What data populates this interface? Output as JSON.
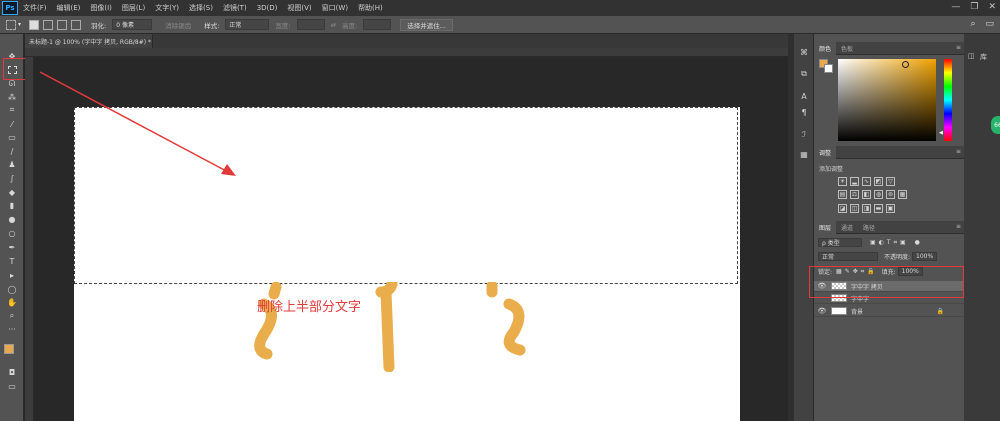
{
  "app": {
    "logo": "Ps"
  },
  "menu": [
    "文件(F)",
    "编辑(E)",
    "图像(I)",
    "图层(L)",
    "文字(Y)",
    "选择(S)",
    "滤镜(T)",
    "3D(D)",
    "视图(V)",
    "窗口(W)",
    "帮助(H)"
  ],
  "window_controls": [
    "—",
    "❐",
    "✕"
  ],
  "options": {
    "feather_label": "羽化:",
    "feather_value": "0 像素",
    "antialias_label": "消除锯齿",
    "style_label": "样式:",
    "style_value": "正常",
    "width_label": "宽度:",
    "height_label": "高度:",
    "select_mask_button": "选择并遮住..."
  },
  "document": {
    "tab_title": "未标题-1 @ 100% (字中字 拷贝, RGB/8#) *",
    "close": "×"
  },
  "annotation": {
    "text": "删除上半部分文字"
  },
  "panels": {
    "color_tabs": [
      "颜色",
      "色板"
    ],
    "adjust_tab": "调整",
    "adjust_label": "添加调整",
    "layers_tabs": [
      "图层",
      "通道",
      "路径"
    ],
    "kind_filter": "ρ 类型",
    "blend_mode": "正常",
    "opacity_label": "不透明度:",
    "opacity_value": "100%",
    "lock_label": "锁定:",
    "fill_label": "填充:",
    "fill_value": "100%",
    "layers": [
      {
        "name": "字中字 拷贝",
        "active": true
      },
      {
        "name": "字中字",
        "active": false
      },
      {
        "name": "背景",
        "active": false
      }
    ]
  },
  "far_right": {
    "label": "库",
    "badge": "66"
  },
  "colors": {
    "accent_red": "#e23a3a",
    "fg_color": "#e9a84d",
    "glyph_color": "#e9ad4c"
  }
}
